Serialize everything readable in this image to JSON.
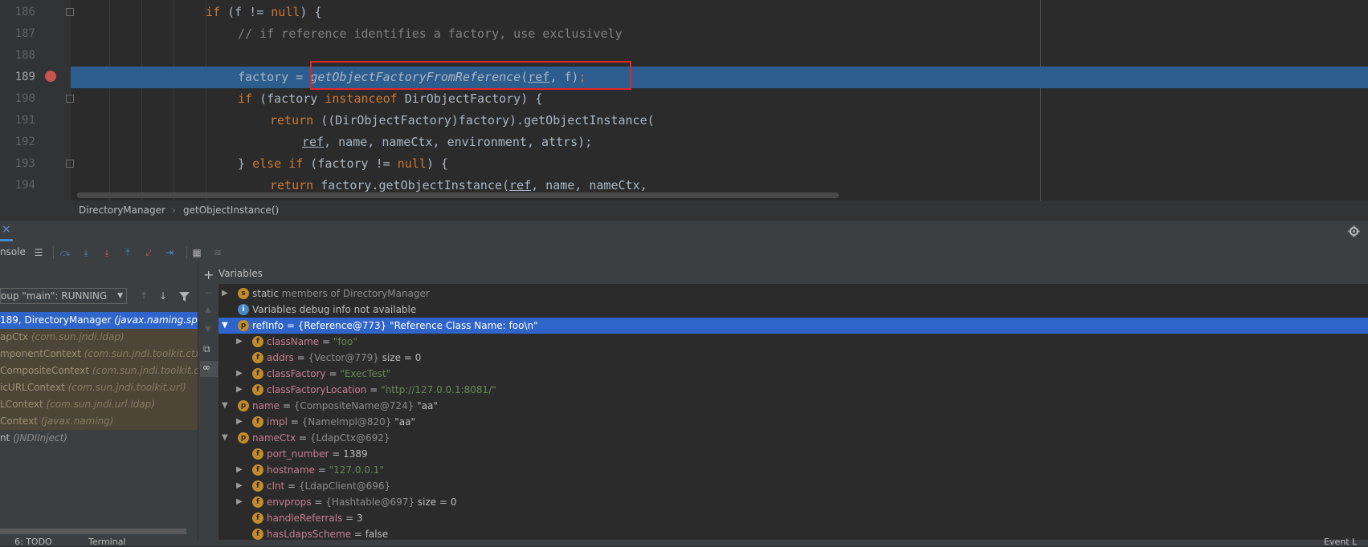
{
  "editor": {
    "lines": [
      {
        "num": "186"
      },
      {
        "num": "187"
      },
      {
        "num": "188"
      },
      {
        "num": "189"
      },
      {
        "num": "190"
      },
      {
        "num": "191"
      },
      {
        "num": "192"
      },
      {
        "num": "193"
      },
      {
        "num": "194"
      }
    ],
    "tokens": {
      "l186": {
        "kw_if": "if",
        "a": " (f != ",
        "kw_null": "null",
        "b": ") {"
      },
      "l187": {
        "comment": "// if reference identifies a factory, use exclusively"
      },
      "l189": {
        "a": "factory = ",
        "call": "getObjectFactoryFromReference",
        "p1": "(",
        "ref": "ref",
        "p2": ", f)",
        "semi": ";"
      },
      "l190": {
        "kw_if": "if",
        "a": " (factory ",
        "kw_inst": "instanceof",
        "b": " DirObjectFactory) {"
      },
      "l191": {
        "kw_ret": "return",
        "a": " ((DirObjectFactory)factory).getObjectInstance("
      },
      "l192": {
        "ref": "ref",
        "a": ", name, nameCtx, environment, attrs);"
      },
      "l193": {
        "a": "} ",
        "kw_else": "else",
        "sp": " ",
        "kw_if": "if",
        "b": " (factory != ",
        "kw_null": "null",
        "c": ") {"
      },
      "l194": {
        "kw_ret": "return",
        "a": " factory.getObjectInstance(",
        "ref": "ref",
        "b": ", name, nameCtx,"
      }
    }
  },
  "breadcrumb": {
    "class": "DirectoryManager",
    "sep": "›",
    "method": "getObjectInstance()"
  },
  "debug": {
    "tab_label": "nsole",
    "close_glyph": "×",
    "thread_select": "oup \"main\": RUNNING",
    "variables_title": "Variables"
  },
  "frames": [
    {
      "name": "189, DirectoryManager",
      "pkg": "(javax.naming.spi)",
      "state": "sel"
    },
    {
      "name": "apCtx",
      "pkg": "(com.sun.jndi.ldap)",
      "state": "lib"
    },
    {
      "name": "mponentContext",
      "pkg": "(com.sun.jndi.toolkit.ctx)",
      "state": "lib"
    },
    {
      "name": "CompositeContext",
      "pkg": "(com.sun.jndi.toolkit.ctx)",
      "state": "lib"
    },
    {
      "name": "icURLContext",
      "pkg": "(com.sun.jndi.toolkit.url)",
      "state": "lib"
    },
    {
      "name": "LContext",
      "pkg": "(com.sun.jndi.url.ldap)",
      "state": "lib"
    },
    {
      "name": "Context",
      "pkg": "(javax.naming)",
      "state": "lib"
    },
    {
      "name": "nt",
      "pkg": "(JNDIInject)",
      "state": "normal"
    }
  ],
  "variables": [
    {
      "indent": 0,
      "arrow": "▶",
      "badge": "s",
      "name": "static",
      "eq": "",
      "ref": "members of DirectoryManager",
      "val": "",
      "kind": "static"
    },
    {
      "indent": 0,
      "arrow": "",
      "badge": "i",
      "name": "Variables debug info not available",
      "eq": "",
      "ref": "",
      "val": "",
      "kind": "info"
    },
    {
      "indent": 0,
      "arrow": "▼",
      "badge": "p",
      "name": "refInfo",
      "eq": " = ",
      "ref": "{Reference@773}",
      "val": " \"Reference Class Name: foo\\n\"",
      "kind": "plain",
      "sel": true
    },
    {
      "indent": 1,
      "arrow": "▶",
      "badge": "f",
      "name": "className",
      "eq": " = ",
      "ref": "",
      "val": "\"foo\"",
      "kind": "str"
    },
    {
      "indent": 1,
      "arrow": "",
      "badge": "f",
      "name": "addrs",
      "eq": " = ",
      "ref": "{Vector@779}",
      "val": "  size = 0",
      "kind": "plain"
    },
    {
      "indent": 1,
      "arrow": "▶",
      "badge": "f",
      "name": "classFactory",
      "eq": " = ",
      "ref": "",
      "val": "\"ExecTest\"",
      "kind": "str"
    },
    {
      "indent": 1,
      "arrow": "▶",
      "badge": "f",
      "name": "classFactoryLocation",
      "eq": " = ",
      "ref": "",
      "val": "\"http://127.0.0.1:8081/\"",
      "kind": "str"
    },
    {
      "indent": 0,
      "arrow": "▼",
      "badge": "p",
      "name": "name",
      "eq": " = ",
      "ref": "{CompositeName@724}",
      "val": " \"aa\"",
      "kind": "plain"
    },
    {
      "indent": 1,
      "arrow": "▶",
      "badge": "f",
      "name": "impl",
      "eq": " = ",
      "ref": "{NameImpl@820}",
      "val": " \"aa\"",
      "kind": "plain"
    },
    {
      "indent": 0,
      "arrow": "▼",
      "badge": "p",
      "name": "nameCtx",
      "eq": " = ",
      "ref": "{LdapCtx@692}",
      "val": "",
      "kind": "plain"
    },
    {
      "indent": 1,
      "arrow": "",
      "badge": "f",
      "name": "port_number",
      "eq": " = ",
      "ref": "",
      "val": "1389",
      "kind": "plain"
    },
    {
      "indent": 1,
      "arrow": "▶",
      "badge": "f",
      "name": "hostname",
      "eq": " = ",
      "ref": "",
      "val": "\"127.0.0.1\"",
      "kind": "str"
    },
    {
      "indent": 1,
      "arrow": "▶",
      "badge": "f",
      "name": "clnt",
      "eq": " = ",
      "ref": "{LdapClient@696}",
      "val": "",
      "kind": "plain"
    },
    {
      "indent": 1,
      "arrow": "▶",
      "badge": "f",
      "name": "envprops",
      "eq": " = ",
      "ref": "{Hashtable@697}",
      "val": "  size = 0",
      "kind": "plain"
    },
    {
      "indent": 1,
      "arrow": "",
      "badge": "f",
      "name": "handleReferrals",
      "eq": " = ",
      "ref": "",
      "val": "3",
      "kind": "plain"
    },
    {
      "indent": 1,
      "arrow": "",
      "badge": "f",
      "name": "hasLdapsScheme",
      "eq": " = ",
      "ref": "",
      "val": "false",
      "kind": "plain"
    }
  ],
  "bottom": {
    "todo": "6: TODO",
    "terminal": "Terminal",
    "event": "Event L"
  },
  "colors": {
    "accent": "#2f65ca",
    "breakpoint": "#c75450",
    "highlight_box": "#e0262c"
  }
}
